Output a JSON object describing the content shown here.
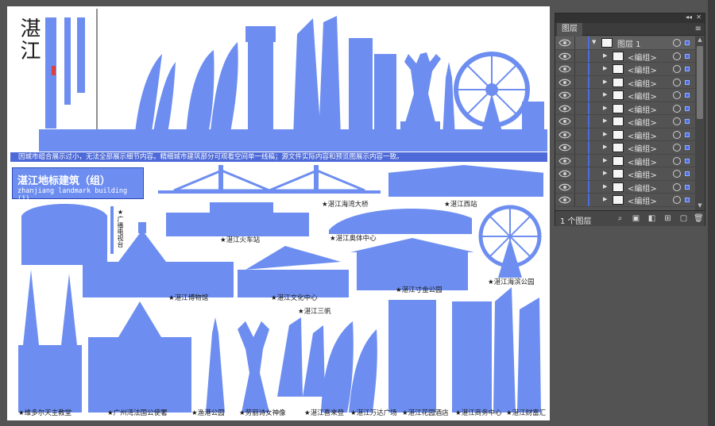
{
  "artboard": {
    "city_name": "湛江",
    "notice": "因城市组合展示过小，无法全部展示细节内容。精细城市建筑部分可观看空间单一线稿；源文件实际内容和预览图展示内容一致。",
    "group_title": "湛江地标建筑（组）",
    "group_subtitle": "zhanjiang landmark building (1)",
    "labels": {
      "bridge": "★湛江海湾大桥",
      "west_station": "★湛江西站",
      "tv_tower": "★广播电视台",
      "railway_station": "★湛江火车站",
      "olympic_center": "★湛江奥体中心",
      "museum": "★湛江博物馆",
      "culture_center": "★湛江文化中心",
      "cun_jin_park": "★湛江寸金公园",
      "seaside_park": "★湛江海滨公园",
      "three_sails": "★湛江三帆",
      "cathedral": "★维多尔天主教堂",
      "guangzhouwan": "★广州湾法国公使署",
      "yugang_park": "★渔港公园",
      "goddess": "★劳丽诗女神像",
      "xilaideng": "★湛江喜来登",
      "wanda": "★湛江万达广场",
      "garden_hotel": "★湛江花园酒店",
      "business_center": "★湛江商务中心",
      "caifu": "★湛江财富汇"
    }
  },
  "layers_panel": {
    "tab_label": "图层",
    "collapse_glyph": "◂◂",
    "close_glyph": "✕",
    "menu_glyph": "≡",
    "top_layer": {
      "name": "图层 1",
      "visible": true,
      "expanded": true
    },
    "groups": [
      {
        "name": "<编组>"
      },
      {
        "name": "<编组>"
      },
      {
        "name": "<编组>"
      },
      {
        "name": "<编组>"
      },
      {
        "name": "<编组>"
      },
      {
        "name": "<编组>"
      },
      {
        "name": "<编组>"
      },
      {
        "name": "<编组>"
      },
      {
        "name": "<编组>"
      },
      {
        "name": "<编组>"
      },
      {
        "name": "<编组>"
      },
      {
        "name": "<编组>"
      }
    ],
    "layer_count": "1 个图层",
    "footer_icons": [
      "search-icon",
      "export-icon",
      "clip-icon",
      "new-sublayer-icon",
      "new-layer-icon",
      "trash-icon"
    ],
    "accent": "#4b6ddf"
  },
  "colors": {
    "artwork": "#6d8ef0",
    "workspace": "#535353",
    "panel": "#535353"
  }
}
